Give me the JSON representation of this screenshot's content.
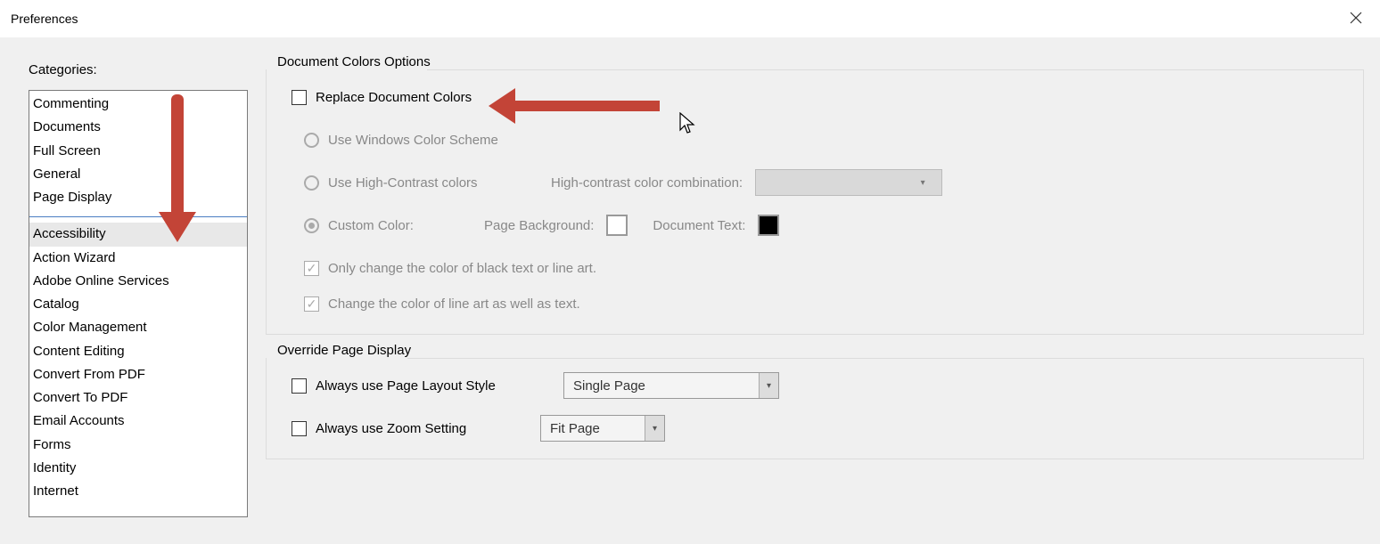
{
  "window": {
    "title": "Preferences"
  },
  "categories_label": "Categories:",
  "categories_top": [
    "Commenting",
    "Documents",
    "Full Screen",
    "General",
    "Page Display"
  ],
  "categories_more": [
    "Accessibility",
    "Action Wizard",
    "Adobe Online Services",
    "Catalog",
    "Color Management",
    "Content Editing",
    "Convert From PDF",
    "Convert To PDF",
    "Email Accounts",
    "Forms",
    "Identity",
    "Internet"
  ],
  "selected_category": "Accessibility",
  "group1": {
    "title": "Document Colors Options",
    "replace_colors": "Replace Document Colors",
    "use_windows": "Use Windows Color Scheme",
    "use_highcontrast": "Use High-Contrast colors",
    "hc_combo_label": "High-contrast color combination:",
    "custom_color": "Custom Color:",
    "page_bg_label": "Page Background:",
    "doc_text_label": "Document Text:",
    "only_black": "Only change the color of black text or line art.",
    "change_lineart": "Change the color of line art as well as text."
  },
  "group2": {
    "title": "Override Page Display",
    "always_layout": "Always use Page Layout Style",
    "layout_value": "Single Page",
    "always_zoom": "Always use Zoom Setting",
    "zoom_value": "Fit Page"
  },
  "colors": {
    "annotation_red": "#c34437"
  }
}
